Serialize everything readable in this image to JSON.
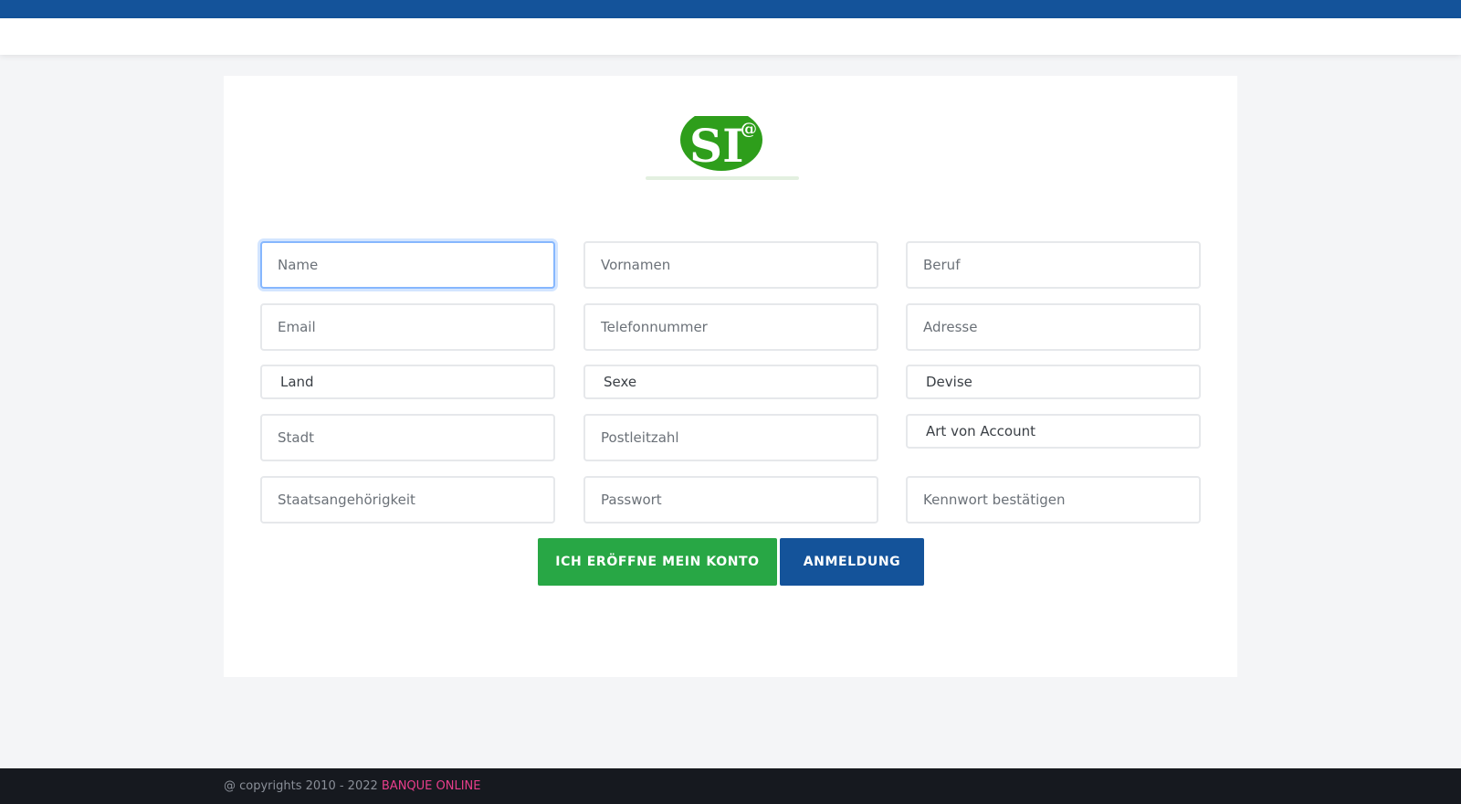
{
  "logo": {
    "alt": "Slim International Bank logo"
  },
  "form": {
    "fields": [
      {
        "name": "name-input",
        "placeholder": "Name"
      },
      {
        "name": "vornamen-input",
        "placeholder": "Vornamen"
      },
      {
        "name": "beruf-input",
        "placeholder": "Beruf"
      },
      {
        "name": "email-input",
        "placeholder": "Email"
      },
      {
        "name": "telefonnummer-input",
        "placeholder": "Telefonnummer"
      },
      {
        "name": "adresse-input",
        "placeholder": "Adresse"
      },
      {
        "name": "land-select",
        "value": "Land"
      },
      {
        "name": "sexe-select",
        "value": "Sexe"
      },
      {
        "name": "devise-select",
        "value": "Devise"
      },
      {
        "name": "stadt-input",
        "placeholder": "Stadt"
      },
      {
        "name": "postleitzahl-input",
        "placeholder": "Postleitzahl"
      },
      {
        "name": "account-type-select",
        "value": "Art von Account"
      },
      {
        "name": "staatsangehoerigkeit-input",
        "placeholder": "Staatsangehörigkeit"
      },
      {
        "name": "passwort-input",
        "placeholder": "Passwort"
      },
      {
        "name": "kennwort-bestaetigen-input",
        "placeholder": "Kennwort bestätigen"
      }
    ],
    "submit_label": "ICH ERÖFFNE MEIN KONTO",
    "login_label": "ANMELDUNG"
  },
  "footer": {
    "copyright": "@ copyrights 2010 - 2022 ",
    "brand": "BANQUE ONLINE"
  },
  "colors": {
    "topbar": "#14539a",
    "primary_button": "#28a745",
    "secondary_button": "#14539a",
    "footer_bg": "#16191f",
    "footer_brand": "#e83e8c"
  }
}
